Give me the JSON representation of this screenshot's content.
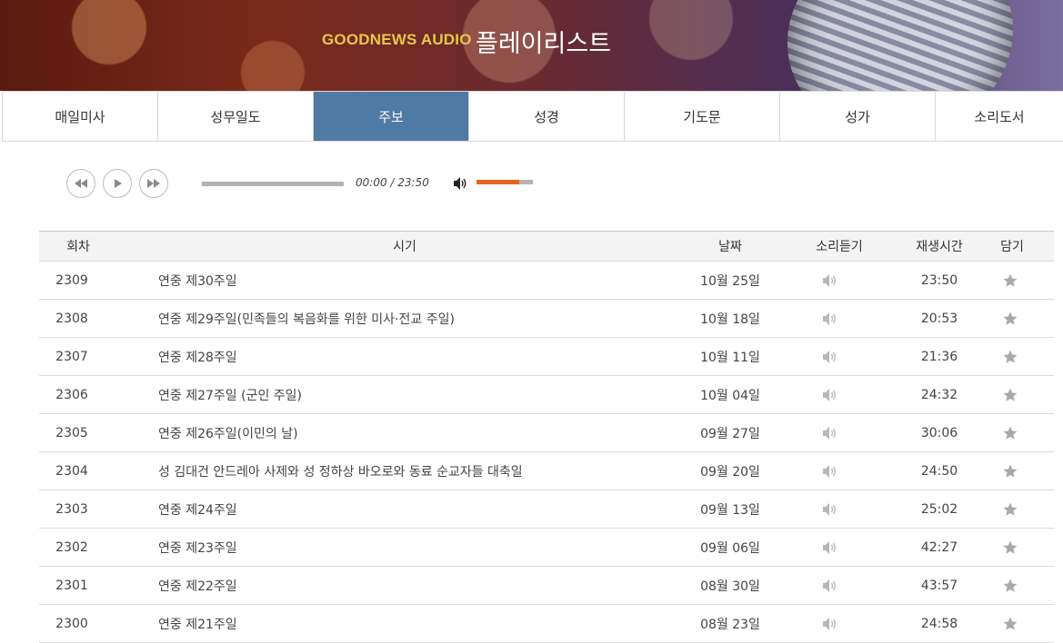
{
  "header": {
    "brand": "GOODNEWS AUDIO",
    "title": "플레이리스트"
  },
  "tabs": [
    {
      "label": "매일미사",
      "active": false
    },
    {
      "label": "성무일도",
      "active": false
    },
    {
      "label": "주보",
      "active": true
    },
    {
      "label": "성경",
      "active": false
    },
    {
      "label": "기도문",
      "active": false
    },
    {
      "label": "성가",
      "active": false
    },
    {
      "label": "소리도서",
      "active": false
    }
  ],
  "player": {
    "time": "00:00 / 23:50",
    "progress": 0,
    "volume": 0.75,
    "icons": [
      "rewind-icon",
      "play-icon",
      "fast-forward-icon",
      "volume-icon"
    ],
    "accent_color": "#e8641b"
  },
  "table": {
    "headers": {
      "no": "회차",
      "title": "시기",
      "date": "날짜",
      "listen": "소리듣기",
      "duration": "재생시간",
      "add": "담기"
    },
    "rows": [
      {
        "no": "2309",
        "title": "연중 제30주일",
        "date": "10월 25일",
        "duration": "23:50"
      },
      {
        "no": "2308",
        "title": "연중 제29주일(민족들의 복음화를 위한 미사·전교 주일)",
        "date": "10월 18일",
        "duration": "20:53"
      },
      {
        "no": "2307",
        "title": "연중 제28주일",
        "date": "10월 11일",
        "duration": "21:36"
      },
      {
        "no": "2306",
        "title": "연중 제27주일 (군인 주일)",
        "date": "10월 04일",
        "duration": "24:32"
      },
      {
        "no": "2305",
        "title": "연중 제26주일(이민의 날)",
        "date": "09월 27일",
        "duration": "30:06"
      },
      {
        "no": "2304",
        "title": "성 김대건 안드레아 사제와 성 정하상 바오로와 동료 순교자들 대축일",
        "date": "09월 20일",
        "duration": "24:50"
      },
      {
        "no": "2303",
        "title": "연중 제24주일",
        "date": "09월 13일",
        "duration": "25:02"
      },
      {
        "no": "2302",
        "title": "연중 제23주일",
        "date": "09월 06일",
        "duration": "42:27"
      },
      {
        "no": "2301",
        "title": "연중 제22주일",
        "date": "08월 30일",
        "duration": "43:57"
      },
      {
        "no": "2300",
        "title": "연중 제21주일",
        "date": "08월 23일",
        "duration": "24:58"
      }
    ]
  }
}
